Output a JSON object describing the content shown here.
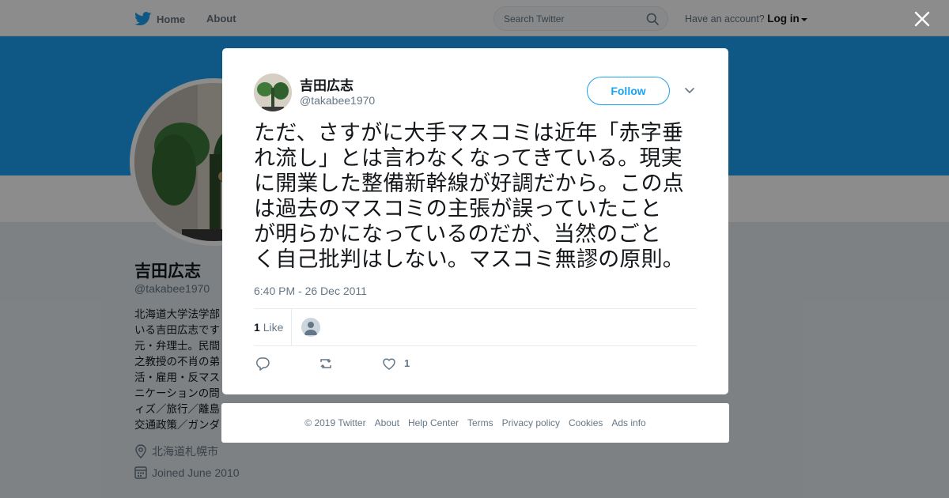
{
  "nav": {
    "home_label": "Home",
    "about_label": "About",
    "search_placeholder": "Search Twitter",
    "account_prompt": "Have an account?",
    "login_label": "Log in"
  },
  "profile": {
    "name": "吉田広志",
    "handle": "@takabee1970",
    "bio_lines": [
      "北海道大学法学部",
      "いる吉田広志です",
      "元・弁理士。民間",
      "之教授の不肖の弟",
      "活・雇用・反マス",
      "ニケーションの問",
      "ィズ／旅行／離島",
      "交通政策／ガンダ"
    ],
    "location": "北海道札幌市",
    "joined": "Joined June 2010"
  },
  "tweet": {
    "author_name": "吉田広志",
    "author_handle": "@takabee1970",
    "follow_label": "Follow",
    "text_lines": [
      "ただ、さすがに大手マスコミは近年「赤字垂",
      "れ流し」とは言わなくなってきている。現実",
      "に開業した整備新幹線が好調だから。この点",
      "は過去のマスコミの主張が誤っていたこと",
      "が明らかになっているのだが、当然のごと",
      "く自己批判はしない。マスコミ無謬の原則。"
    ],
    "timestamp": "6:40 PM - 26 Dec 2011",
    "likes_count": "1",
    "likes_label": "Like",
    "action_like_count": "1"
  },
  "footer": {
    "links": [
      "© 2019 Twitter",
      "About",
      "Help Center",
      "Terms",
      "Privacy policy",
      "Cookies",
      "Ads info"
    ]
  },
  "colors": {
    "brand": "#1da1f2",
    "overlay": "rgba(0,0,0,0.45)",
    "text_primary": "#14171a",
    "text_secondary": "#657786"
  },
  "icons": [
    "twitter-bird-icon",
    "search-icon",
    "close-icon",
    "chevron-down-icon",
    "location-icon",
    "calendar-icon",
    "reply-icon",
    "retweet-icon",
    "heart-icon",
    "default-avatar-icon"
  ]
}
